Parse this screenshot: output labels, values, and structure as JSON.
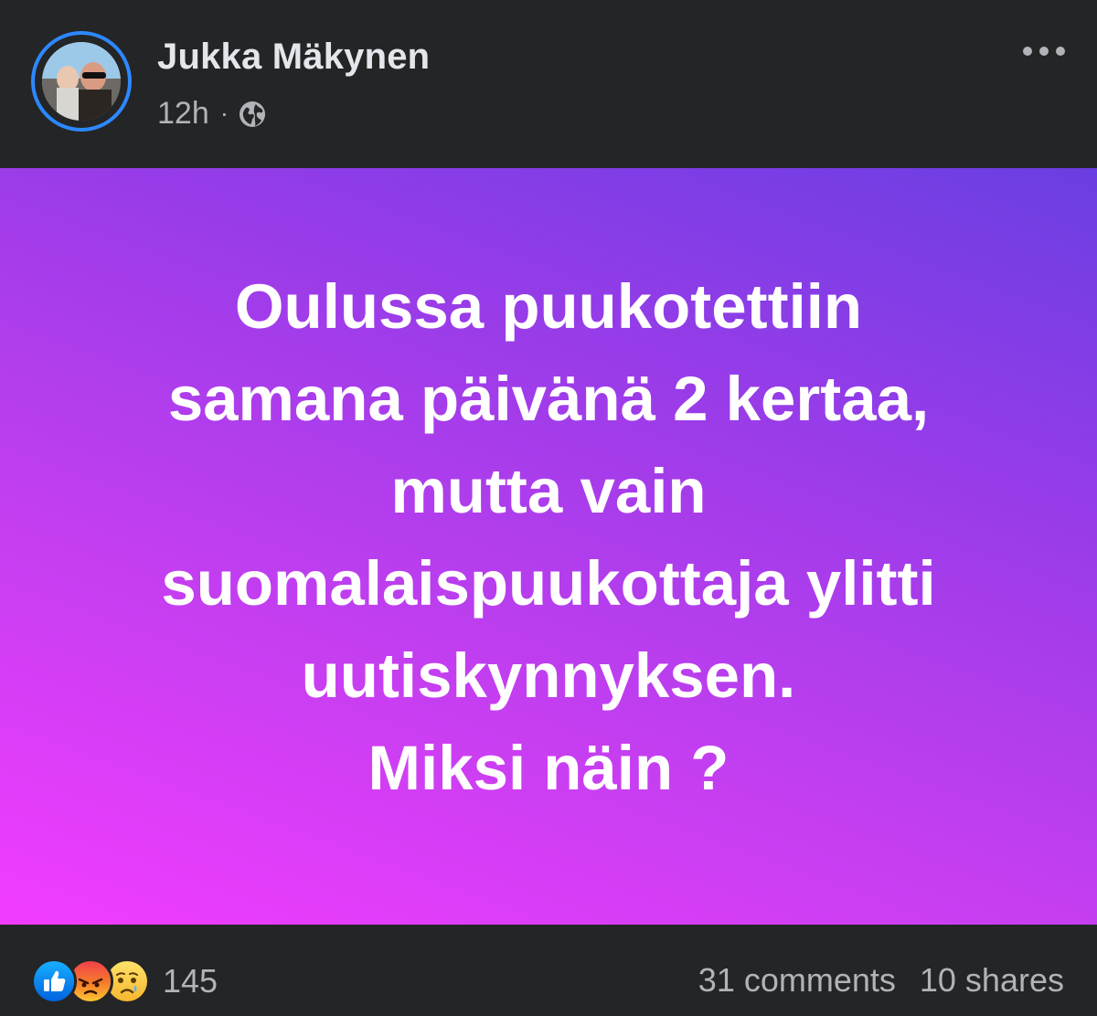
{
  "post": {
    "author": "Jukka Mäkynen",
    "time": "12h",
    "separator": "·",
    "privacy_icon": "globe-icon",
    "menu_icon": "more-horizontal-icon",
    "background_colors": [
      "#f23cff",
      "#6a3ee2"
    ],
    "text_lines": [
      "Oulussa puukotettiin",
      "samana päivänä 2 kertaa,",
      "mutta vain",
      "suomalaispuukottaja ylitti",
      "uutiskynnyksen.",
      "Miksi näin ?"
    ]
  },
  "footer": {
    "reaction_icons": [
      "like-icon",
      "angry-icon",
      "sad-icon"
    ],
    "reaction_count": "145",
    "comments": "31 comments",
    "shares": "10 shares"
  },
  "colors": {
    "background": "#242526",
    "accent_ring": "#2d88ff",
    "text_primary": "#e4e6eb",
    "text_secondary": "#b0b3b8"
  }
}
